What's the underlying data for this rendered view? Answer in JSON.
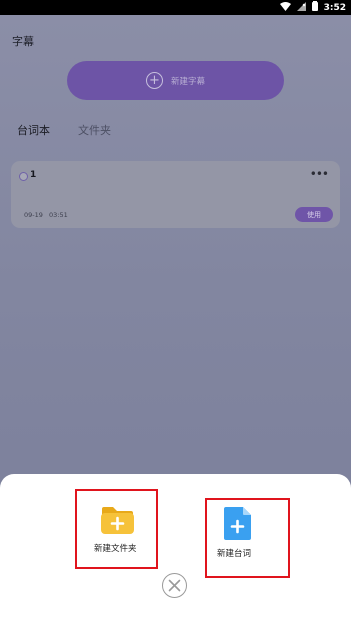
{
  "status_bar": {
    "time": "3:52"
  },
  "page": {
    "title": "字幕"
  },
  "new_subtitle_button": {
    "label": "新建字幕"
  },
  "tabs": [
    {
      "label": "台词本",
      "active": true
    },
    {
      "label": "文件夹",
      "active": false
    }
  ],
  "script_card": {
    "title": "1",
    "date": "09-19",
    "time": "03:51",
    "use_label": "使用"
  },
  "bottom_sheet": {
    "actions": [
      {
        "label": "新建文件夹",
        "icon": "folder-plus-icon"
      },
      {
        "label": "新建台词",
        "icon": "document-plus-icon"
      }
    ],
    "close_icon": "close-icon"
  },
  "colors": {
    "accent": "#6d54a6",
    "overlay": "#7f84a0",
    "folder": "#f6c23a",
    "document": "#3aa0f0",
    "highlight": "#e0141d"
  }
}
